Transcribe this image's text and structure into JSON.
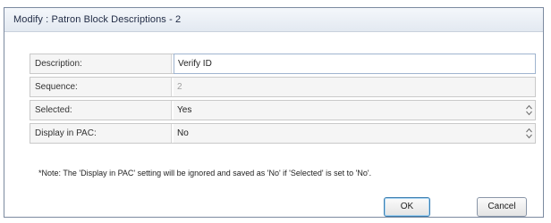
{
  "window": {
    "title": "Modify : Patron Block Descriptions - 2"
  },
  "fields": {
    "description": {
      "label": "Description:",
      "value": "Verify ID"
    },
    "sequence": {
      "label": "Sequence:",
      "value": "2"
    },
    "selected": {
      "label": "Selected:",
      "value": "Yes"
    },
    "display_in_pac": {
      "label": "Display in PAC:",
      "value": "No"
    }
  },
  "note": "*Note: The 'Display in PAC' setting will be ignored and saved as 'No' if 'Selected' is set to 'No'.",
  "buttons": {
    "ok": "OK",
    "cancel": "Cancel"
  }
}
